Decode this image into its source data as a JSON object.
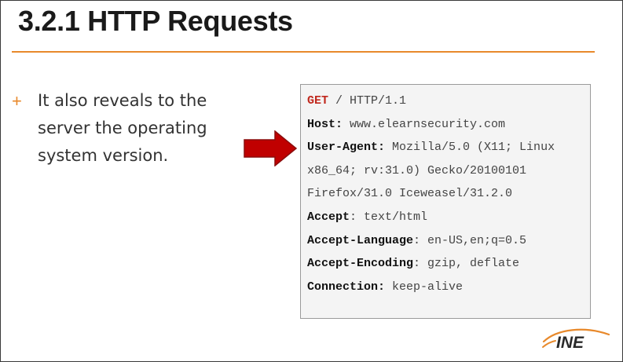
{
  "title": "3.2.1 HTTP Requests",
  "bullet": {
    "marker": "+",
    "lines": [
      "It also reveals to the",
      "server the operating",
      "system version."
    ]
  },
  "request": {
    "request_line": {
      "method": "GET",
      "rest": " / HTTP/1.1"
    },
    "host": {
      "key": "Host:",
      "value": " www.elearnsecurity.com"
    },
    "user_agent": {
      "key": "User-Agent:",
      "line1": " Mozilla/5.0 (X11; Linux",
      "line2": "x86_64; rv:31.0) Gecko/20100101",
      "line3": "Firefox/31.0 Iceweasel/31.2.0"
    },
    "accept": {
      "key": "Accept",
      "value": ": text/html"
    },
    "accept_language": {
      "key": "Accept-Language",
      "value": ": en-US,en;q=0.5"
    },
    "accept_encoding": {
      "key": "Accept-Encoding",
      "value": ": gzip, deflate"
    },
    "connection": {
      "key": "Connection:",
      "value": " keep-alive"
    }
  },
  "logo": {
    "text": "INE"
  },
  "colors": {
    "accent": "#e8892b",
    "arrow": "#c00000",
    "method": "#c0281d"
  },
  "icons": {
    "arrow": "right-arrow-icon",
    "logo": "ine-logo"
  }
}
